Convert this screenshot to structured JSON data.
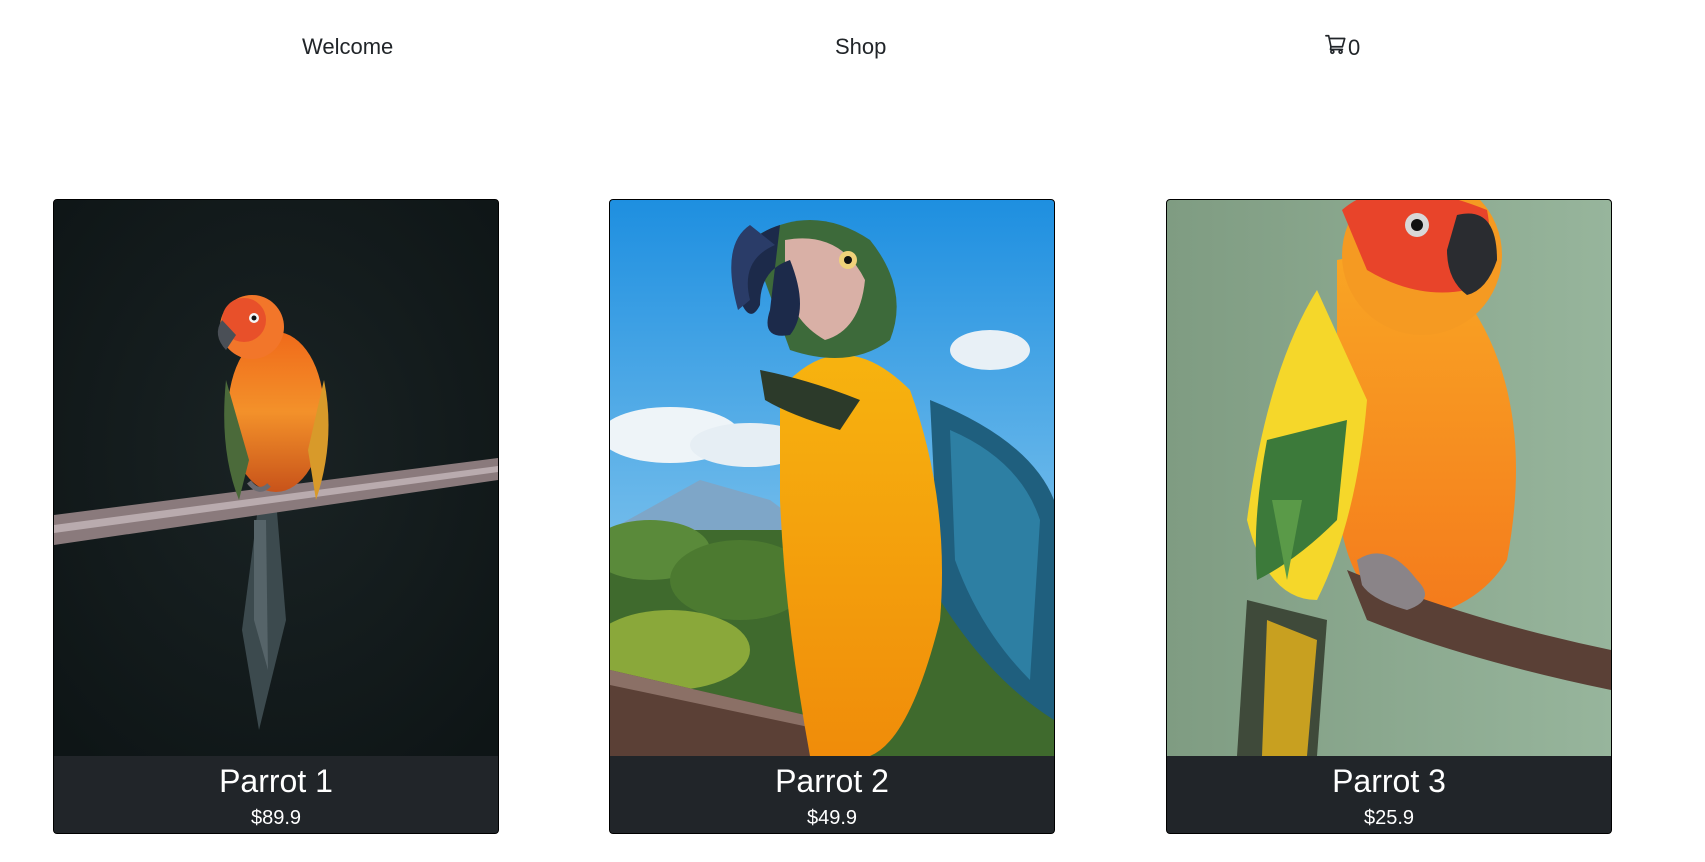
{
  "nav": {
    "welcome_label": "Welcome",
    "shop_label": "Shop",
    "cart_icon": "cart-icon",
    "cart_count": "0"
  },
  "products": [
    {
      "name": "Parrot 1",
      "price": "$89.9"
    },
    {
      "name": "Parrot 2",
      "price": "$49.9"
    },
    {
      "name": "Parrot 3",
      "price": "$25.9"
    }
  ],
  "colors": {
    "text": "#212529",
    "caption_bg": "#212529",
    "caption_text": "#ffffff",
    "card_border": "#000000"
  }
}
